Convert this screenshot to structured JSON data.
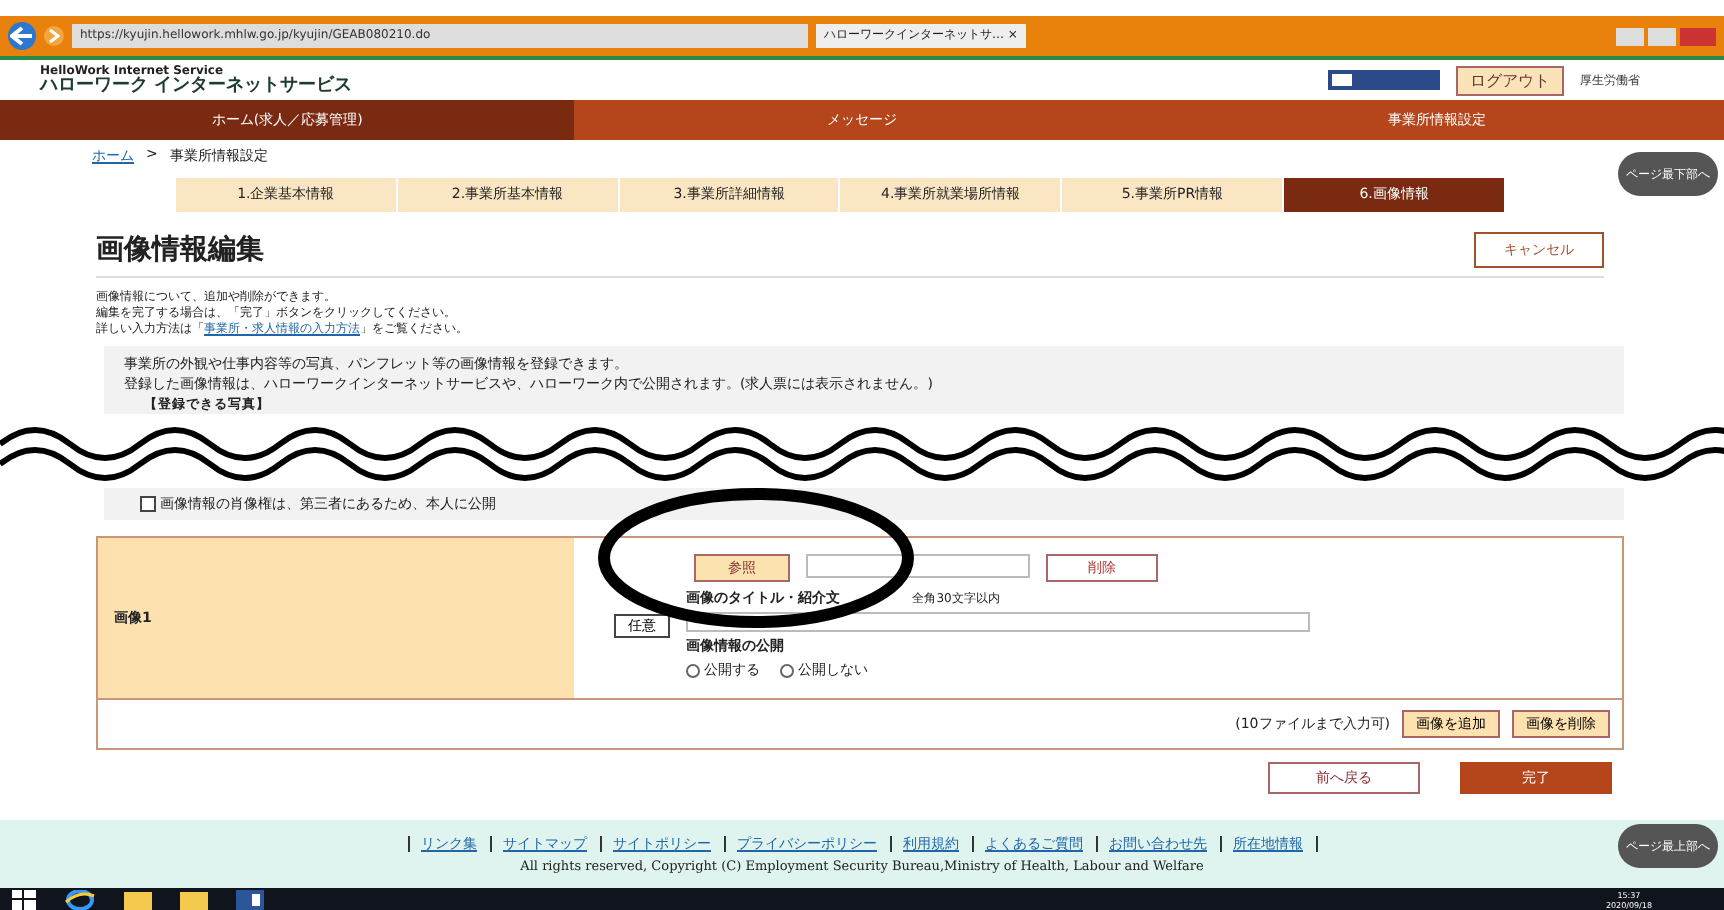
{
  "browser": {
    "url": "https://kyujin.hellowork.mhlw.go.jp/kyujin/GEAB080210.do",
    "tab": "ハローワークインターネットサ…",
    "tab_close": "×"
  },
  "header": {
    "service_en": "HelloWork Internet Service",
    "service_ja": "ハローワーク インターネットサービス",
    "logout": "ログアウト",
    "ministry": "厚生労働省"
  },
  "nav": [
    {
      "label": "ホーム(求人／応募管理)",
      "selected": true
    },
    {
      "label": "メッセージ",
      "selected": false
    },
    {
      "label": "事業所情報設定",
      "selected": false
    }
  ],
  "breadcrumb": {
    "home": "ホーム",
    "separator": ">",
    "current": "事業所情報設定"
  },
  "steps": [
    {
      "label": "1.企業基本情報",
      "selected": false
    },
    {
      "label": "2.事業所基本情報",
      "selected": false
    },
    {
      "label": "3.事業所詳細情報",
      "selected": false
    },
    {
      "label": "4.事業所就業場所情報",
      "selected": false
    },
    {
      "label": "5.事業所PR情報",
      "selected": false
    },
    {
      "label": "6.画像情報",
      "selected": true
    }
  ],
  "page_title": "画像情報編集",
  "cancel": "キャンセル",
  "intro": [
    "画像情報について、追加や削除ができます。",
    "編集を完了する場合は、「完了」ボタンをクリックしてください。"
  ],
  "intro_link": {
    "before": "詳しい入力方法は「",
    "link": "事業所・求人情報の入力方法",
    "after": "」をご覧ください。"
  },
  "info_box": [
    "事業所の外観や仕事内容等の写真、パンフレット等の画像情報を登録できます。",
    "登録した画像情報は、ハローワークインターネットサービスや、ハローワーク内で公開されます。(求人票には表示されません。)"
  ],
  "info_heading": "【登録できる写真】",
  "portrait_notice": {
    "text": "画像情報の肖像権は、第三者にあるため、本人に公開",
    "checked": false
  },
  "images": [
    {
      "label": "画像1",
      "browse": "参照",
      "delete": "削除",
      "optional": "任意",
      "title_label": "画像のタイトル・紹介文",
      "title_hint": "全角30文字以内",
      "publish_label": "画像情報の公開",
      "options": [
        {
          "label": "公開する",
          "selected": false
        },
        {
          "label": "公開しない",
          "selected": false
        }
      ]
    }
  ],
  "limit_note": "(10ファイルまで入力可)",
  "add_image": "画像を追加",
  "remove_image": "画像を削除",
  "back": "前へ戻る",
  "done": "完了",
  "page_bottom": "ページ最下部へ",
  "page_top": "ページ最上部へ",
  "footer_links": [
    "リンク集",
    "サイトマップ",
    "サイトポリシー",
    "プライバシーポリシー",
    "利用規約",
    "よくあるご質問",
    "お問い合わせ先",
    "所在地情報"
  ],
  "copyright": "All rights reserved, Copyright (C) Employment Security Bureau,Ministry of Health, Labour and Welfare",
  "taskbar": {
    "time": "15:37",
    "date": "2020/09/18"
  }
}
